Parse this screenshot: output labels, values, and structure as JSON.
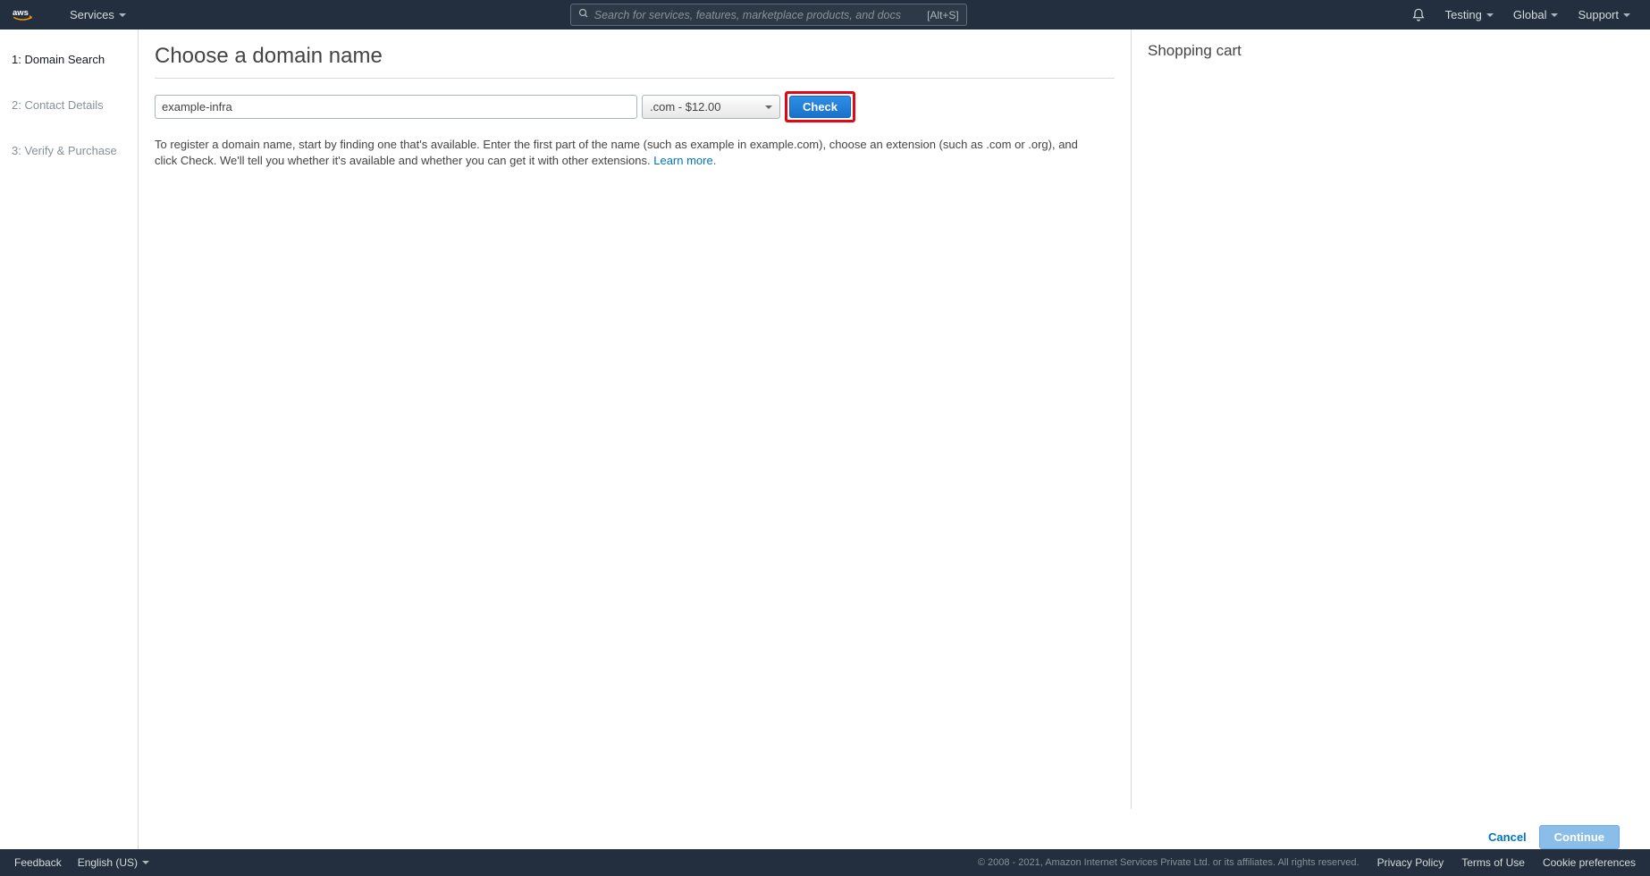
{
  "header": {
    "services_label": "Services",
    "search_placeholder": "Search for services, features, marketplace products, and docs",
    "search_kbd": "[Alt+S]",
    "account_label": "Testing",
    "region_label": "Global",
    "support_label": "Support"
  },
  "sidebar": {
    "steps": [
      {
        "label": "1: Domain Search",
        "active": true
      },
      {
        "label": "2: Contact Details",
        "active": false
      },
      {
        "label": "3: Verify & Purchase",
        "active": false
      }
    ]
  },
  "main": {
    "title": "Choose a domain name",
    "domain_value": "example-infra",
    "tld_value": ".com - $12.00",
    "check_label": "Check",
    "instructions_text": "To register a domain name, start by finding one that's available. Enter the first part of the name (such as example in example.com), choose an extension (such as .com or .org), and click Check. We'll tell you whether it's available and whether you can get it with other extensions. ",
    "learn_more": "Learn more."
  },
  "cart": {
    "title": "Shopping cart"
  },
  "actions": {
    "cancel": "Cancel",
    "continue": "Continue"
  },
  "footer": {
    "feedback": "Feedback",
    "language": "English (US)",
    "copyright": "© 2008 - 2021, Amazon Internet Services Private Ltd. or its affiliates. All rights reserved.",
    "privacy": "Privacy Policy",
    "terms": "Terms of Use",
    "cookies": "Cookie preferences"
  }
}
